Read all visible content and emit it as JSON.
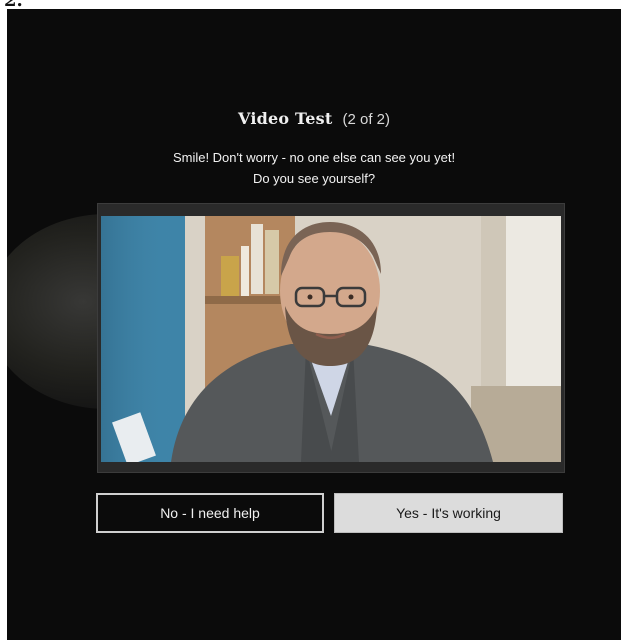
{
  "corner_glyph": "2.",
  "dialog": {
    "title": "Video Test",
    "step": "(2 of 2)",
    "subtitle_line1": "Smile! Don't worry - no one else can see you yet!",
    "subtitle_line2": "Do you see yourself?"
  },
  "video_preview": {
    "content": "webcam-self-view"
  },
  "buttons": {
    "no_label": "No - I need help",
    "yes_label": "Yes - It's working"
  },
  "colors": {
    "background": "#0b0b0b",
    "text": "#f0f0f0",
    "secondary_button": "#dcdcdc"
  }
}
